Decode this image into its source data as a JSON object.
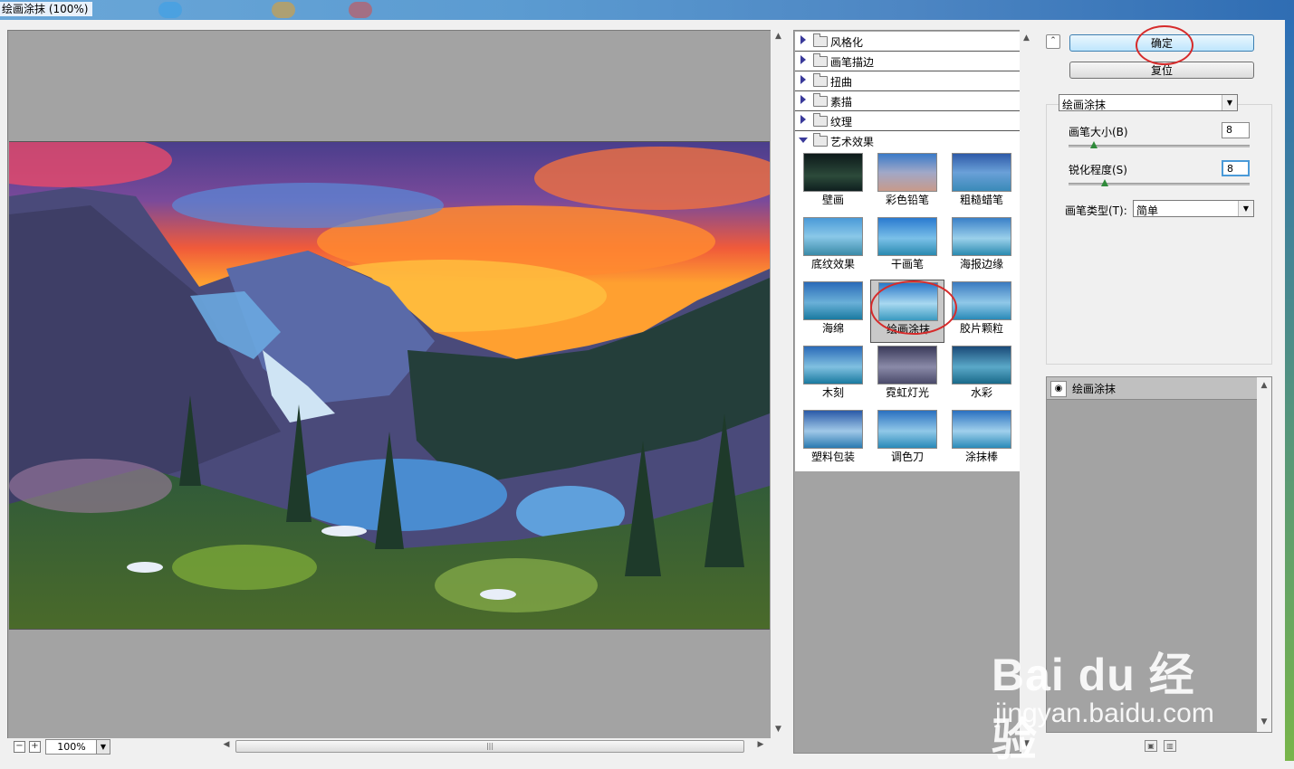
{
  "window": {
    "title": "绘画涂抹 (100%)"
  },
  "preview": {
    "zoom": "100%"
  },
  "gallery": {
    "categories": [
      {
        "label": "风格化",
        "expanded": false
      },
      {
        "label": "画笔描边",
        "expanded": false
      },
      {
        "label": "扭曲",
        "expanded": false
      },
      {
        "label": "素描",
        "expanded": false
      },
      {
        "label": "纹理",
        "expanded": false
      },
      {
        "label": "艺术效果",
        "expanded": true
      }
    ],
    "filters": [
      "壁画",
      "彩色铅笔",
      "粗糙蜡笔",
      "底纹效果",
      "干画笔",
      "海报边缘",
      "海绵",
      "绘画涂抹",
      "胶片颗粒",
      "木刻",
      "霓虹灯光",
      "水彩",
      "塑料包装",
      "调色刀",
      "涂抹棒"
    ],
    "selected": "绘画涂抹"
  },
  "buttons": {
    "ok": "确定",
    "reset": "复位"
  },
  "filter_select": {
    "value": "绘画涂抹"
  },
  "params": {
    "brush_size": {
      "label": "画笔大小(B)",
      "value": "8",
      "fraction": 0.2
    },
    "sharpness": {
      "label": "锐化程度(S)",
      "value": "8",
      "fraction": 0.2
    },
    "brush_type": {
      "label": "画笔类型(T):",
      "value": "简单"
    }
  },
  "layers": [
    {
      "name": "绘画涂抹",
      "visible": true
    }
  ],
  "watermark": {
    "brand": "Bai du 经验",
    "url": "jingyan.baidu.com"
  },
  "colors": {
    "accent_circle": "#d62b2b",
    "titlebar": "#4d86c3",
    "panel_gray": "#a3a3a3"
  }
}
